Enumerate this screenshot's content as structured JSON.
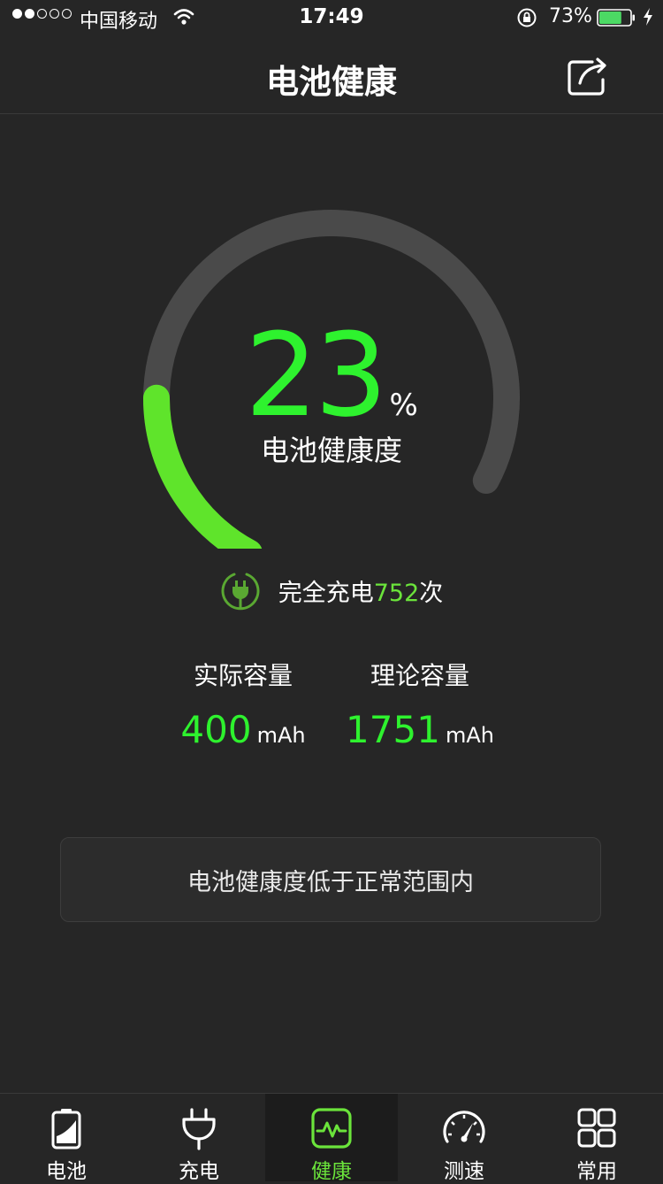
{
  "status_bar": {
    "carrier": "中国移动",
    "time": "17:49",
    "battery_percent": "73%",
    "battery_level": 0.73,
    "signal_strength": 2,
    "signal_max": 5
  },
  "nav": {
    "title": "电池健康",
    "share_icon": "share-icon"
  },
  "health": {
    "value": "23",
    "unit": "%",
    "label": "电池健康度",
    "fraction": 0.23
  },
  "cycles": {
    "prefix": "完全充电",
    "count": "752",
    "suffix": "次"
  },
  "capacity": {
    "actual_label": "实际容量",
    "actual_value": "400",
    "actual_unit": "mAh",
    "design_label": "理论容量",
    "design_value": "1751",
    "design_unit": "mAh"
  },
  "notice": "电池健康度低于正常范围内",
  "tabs": [
    {
      "label": "电池",
      "icon": "battery-icon"
    },
    {
      "label": "充电",
      "icon": "plug-icon"
    },
    {
      "label": "健康",
      "icon": "pulse-icon",
      "active": true
    },
    {
      "label": "测速",
      "icon": "speedometer-icon"
    },
    {
      "label": "常用",
      "icon": "grid-icon"
    }
  ],
  "colors": {
    "accent": "#6be43b",
    "number_green": "#2ef22e",
    "background": "#262626",
    "track": "#4a4a4a"
  }
}
